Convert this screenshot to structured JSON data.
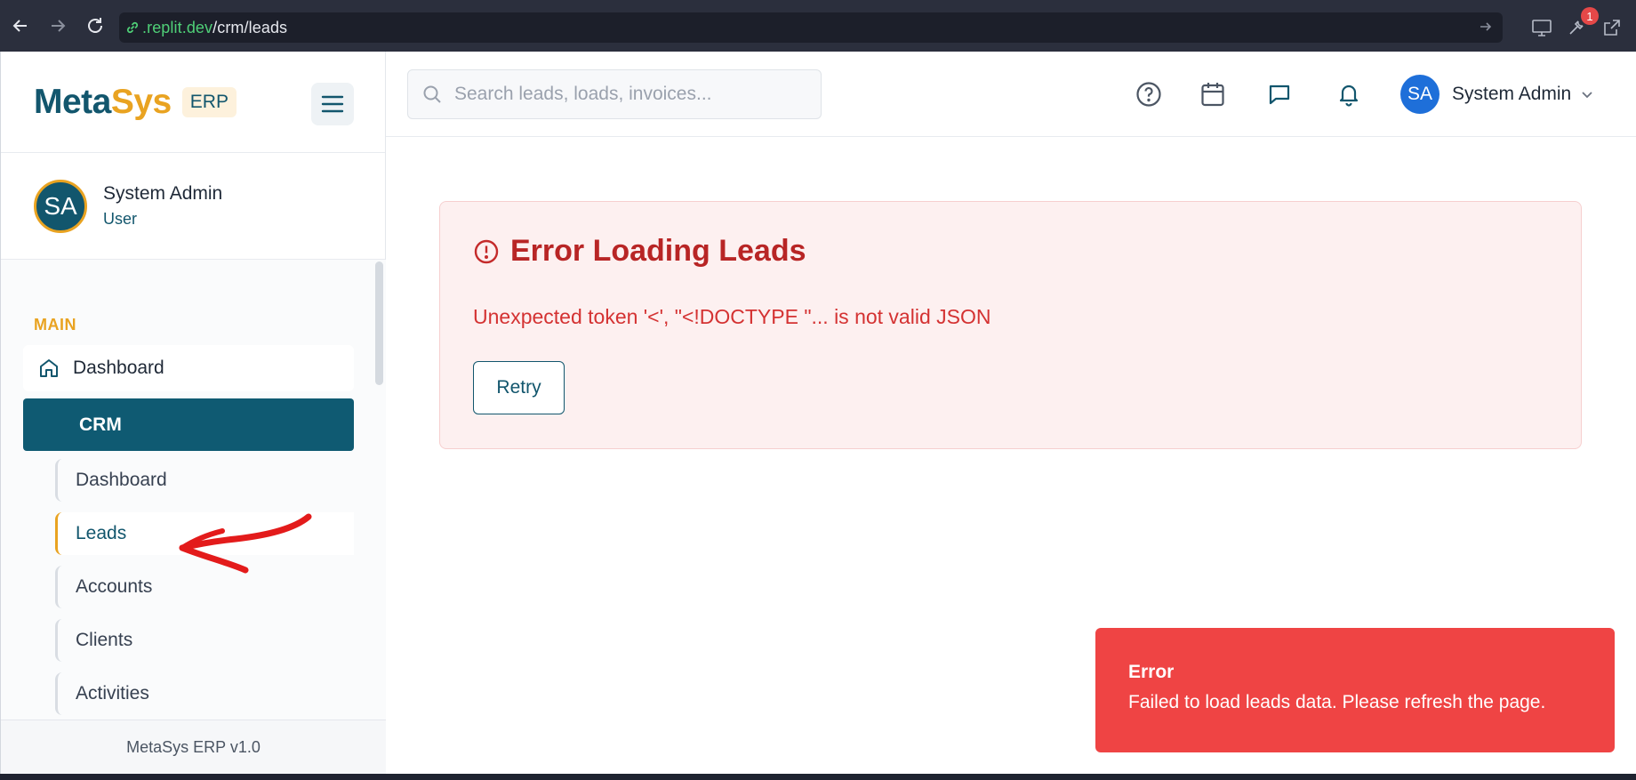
{
  "browser": {
    "url_host": ".replit.dev",
    "url_path": "/crm/leads",
    "extension_badge": "1"
  },
  "sidebar": {
    "brand": {
      "part1": "Meta",
      "part2": "Sys",
      "badge": "ERP"
    },
    "user": {
      "initials": "SA",
      "name": "System Admin",
      "role": "User"
    },
    "section_label": "MAIN",
    "dashboard_label": "Dashboard",
    "crm_label": "CRM",
    "sub_items": [
      {
        "label": "Dashboard",
        "active": false
      },
      {
        "label": "Leads",
        "active": true
      },
      {
        "label": "Accounts",
        "active": false
      },
      {
        "label": "Clients",
        "active": false
      },
      {
        "label": "Activities",
        "active": false
      }
    ],
    "footer": "MetaSys ERP v1.0"
  },
  "topbar": {
    "search_placeholder": "Search leads, loads, invoices...",
    "user_initials": "SA",
    "user_name": "System Admin"
  },
  "error_panel": {
    "title": "Error Loading Leads",
    "message": "Unexpected token '<', \"<!DOCTYPE \"... is not valid JSON",
    "retry_label": "Retry"
  },
  "toast": {
    "title": "Error",
    "body": "Failed to load leads data. Please refresh the page."
  },
  "colors": {
    "brand_primary": "#12566d",
    "brand_accent": "#e9a321",
    "error_text": "#b82525",
    "toast_bg": "#ef4444",
    "annotation": "#e31b1b"
  }
}
